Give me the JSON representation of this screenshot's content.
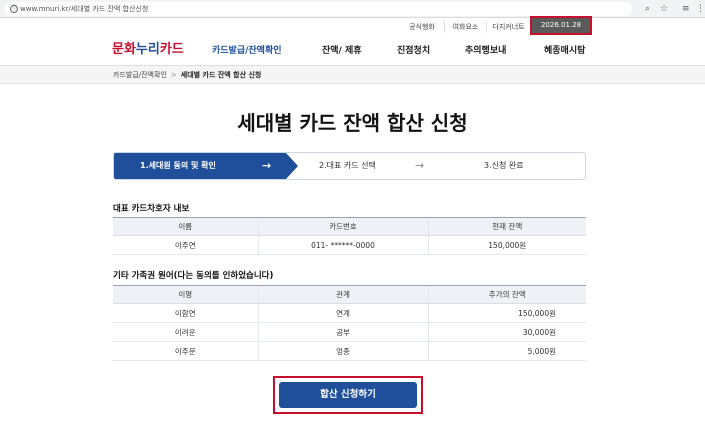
{
  "browser": {
    "url": "www.mnuri.kr/세대별 카드 잔액 합산신청",
    "lock_icon": "ⓘ",
    "icons": [
      "search-icon",
      "star-icon",
      "menu-icon",
      "kebab-icon"
    ]
  },
  "utility": {
    "items": [
      "공식행화",
      "여화요소",
      "다지커너트"
    ],
    "date": "2026.01.28"
  },
  "nav": {
    "logo_part1": "문화",
    "logo_part2": "누리",
    "logo_part3": "카드",
    "menu": [
      "카드발급/잔액확인",
      "잔액/ 제휴",
      "진점청치",
      "추의행보내",
      "혜종매시탐"
    ]
  },
  "breadcrumb": {
    "parent": "카드발급/잔액확인",
    "separator": ">",
    "current": "세대별 카드 잔액 합산 신청"
  },
  "page_title": "세대별 카드 잔액 합산 신청",
  "steps": [
    {
      "label": "1.세대원 동의 및 확인",
      "arrow": "→"
    },
    {
      "label": "2.대표 카드 선택",
      "arrow": "→"
    },
    {
      "label": "3.신청 완료",
      "arrow": ""
    }
  ],
  "rep_section": {
    "title": "대표 카드차호자 내보",
    "headers": [
      "이름",
      "카드번호",
      "현재 잔액"
    ],
    "rows": [
      [
        "이주연",
        "011- ******-0000",
        "150,000원"
      ]
    ]
  },
  "family_section": {
    "title": "기타 가족권 원어(다는 동의를 인하었습니다)",
    "headers": [
      "이명",
      "관계",
      "추가의 잔액"
    ],
    "rows": [
      [
        "이함연",
        "연계",
        "150,000원"
      ],
      [
        "이려운",
        "공부",
        "30,000원"
      ],
      [
        "이주문",
        "엉종",
        "5,000원"
      ]
    ]
  },
  "submit_label": "합산 신청하기",
  "colors": {
    "brand_blue": "#1f4f9a",
    "highlight_red": "#c8102e",
    "logo_red": "#c8102e"
  }
}
